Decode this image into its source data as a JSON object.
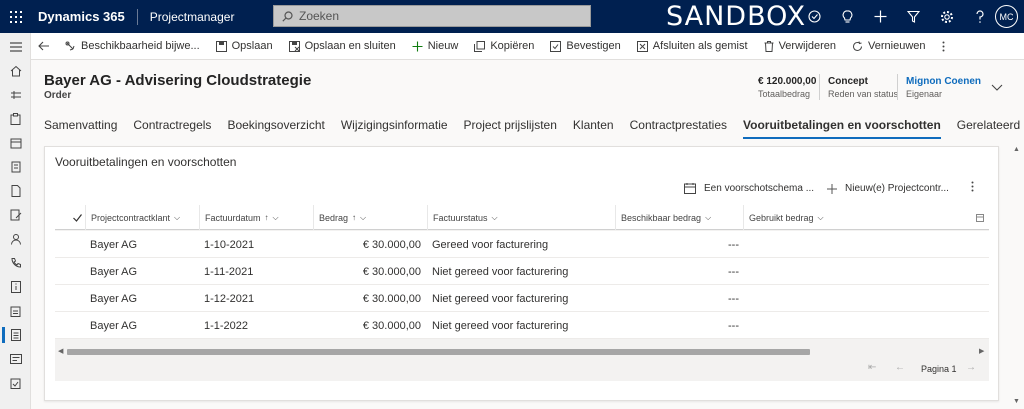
{
  "app": {
    "brand": "Dynamics 365",
    "name": "Projectmanager",
    "search_placeholder": "Zoeken",
    "environment": "SANDBOX",
    "avatar_initials": "MC",
    "top_icons": [
      "task-icon",
      "lightbulb-icon",
      "plus-icon",
      "filter-icon",
      "gear-icon",
      "help-icon"
    ]
  },
  "left_nav": {
    "icons": [
      "hamburger-icon",
      "home-icon",
      "recent-icon",
      "clipboard-icon",
      "calendar-icon",
      "document-stack-icon",
      "document-icon",
      "document-edit-icon",
      "person-icon",
      "phone-icon",
      "info-document-icon",
      "clipboard-list-icon",
      "order-icon",
      "id-card-icon",
      "clipboard-check-icon"
    ],
    "active_index": 12
  },
  "command_bar": {
    "items": [
      {
        "label": "Beschikbaarheid bijwe...",
        "icon": "availability-icon"
      },
      {
        "label": "Opslaan",
        "icon": "save-icon"
      },
      {
        "label": "Opslaan en sluiten",
        "icon": "save-close-icon"
      },
      {
        "label": "Nieuw",
        "icon": "plus-icon"
      },
      {
        "label": "Kopiëren",
        "icon": "copy-icon"
      },
      {
        "label": "Bevestigen",
        "icon": "confirm-icon"
      },
      {
        "label": "Afsluiten als gemist",
        "icon": "close-lost-icon"
      },
      {
        "label": "Verwijderen",
        "icon": "delete-icon"
      },
      {
        "label": "Vernieuwen",
        "icon": "refresh-icon"
      }
    ]
  },
  "header": {
    "title": "Bayer AG - Advisering Cloudstrategie",
    "subtitle": "Order",
    "fields": [
      {
        "value": "€ 120.000,00",
        "label": "Totaalbedrag"
      },
      {
        "value": "Concept",
        "label": "Reden van status"
      },
      {
        "value": "Mignon Coenen",
        "label": "Eigenaar"
      }
    ]
  },
  "tabs": [
    {
      "label": "Samenvatting",
      "active": false
    },
    {
      "label": "Contractregels",
      "active": false
    },
    {
      "label": "Boekingsoverzicht",
      "active": false
    },
    {
      "label": "Wijzigingsinformatie",
      "active": false
    },
    {
      "label": "Project prijslijsten",
      "active": false
    },
    {
      "label": "Klanten",
      "active": false
    },
    {
      "label": "Contractprestaties",
      "active": false
    },
    {
      "label": "Vooruitbetalingen en voorschotten",
      "active": true
    },
    {
      "label": "Gerelateerd",
      "active": false
    }
  ],
  "section": {
    "title": "Vooruitbetalingen en voorschotten",
    "buttons": {
      "schedule": "Een voorschotschema ...",
      "new": "Nieuw(e) Projectcontr..."
    },
    "columns": [
      {
        "label": "Projectcontractklant",
        "sort": ""
      },
      {
        "label": "Factuurdatum",
        "sort": "↑"
      },
      {
        "label": "Bedrag",
        "sort": "↑"
      },
      {
        "label": "Factuurstatus",
        "sort": ""
      },
      {
        "label": "Beschikbaar bedrag",
        "sort": ""
      },
      {
        "label": "Gebruikt bedrag",
        "sort": ""
      }
    ],
    "rows": [
      {
        "klant": "Bayer AG",
        "datum": "1-10-2021",
        "bedrag": "€ 30.000,00",
        "status": "Gereed voor facturering",
        "beschikbaar": "---"
      },
      {
        "klant": "Bayer AG",
        "datum": "1-11-2021",
        "bedrag": "€ 30.000,00",
        "status": "Niet gereed voor facturering",
        "beschikbaar": "---"
      },
      {
        "klant": "Bayer AG",
        "datum": "1-12-2021",
        "bedrag": "€ 30.000,00",
        "status": "Niet gereed voor facturering",
        "beschikbaar": "---"
      },
      {
        "klant": "Bayer AG",
        "datum": "1-1-2022",
        "bedrag": "€ 30.000,00",
        "status": "Niet gereed voor facturering",
        "beschikbaar": "---"
      }
    ],
    "pager": {
      "label": "Pagina 1"
    }
  }
}
